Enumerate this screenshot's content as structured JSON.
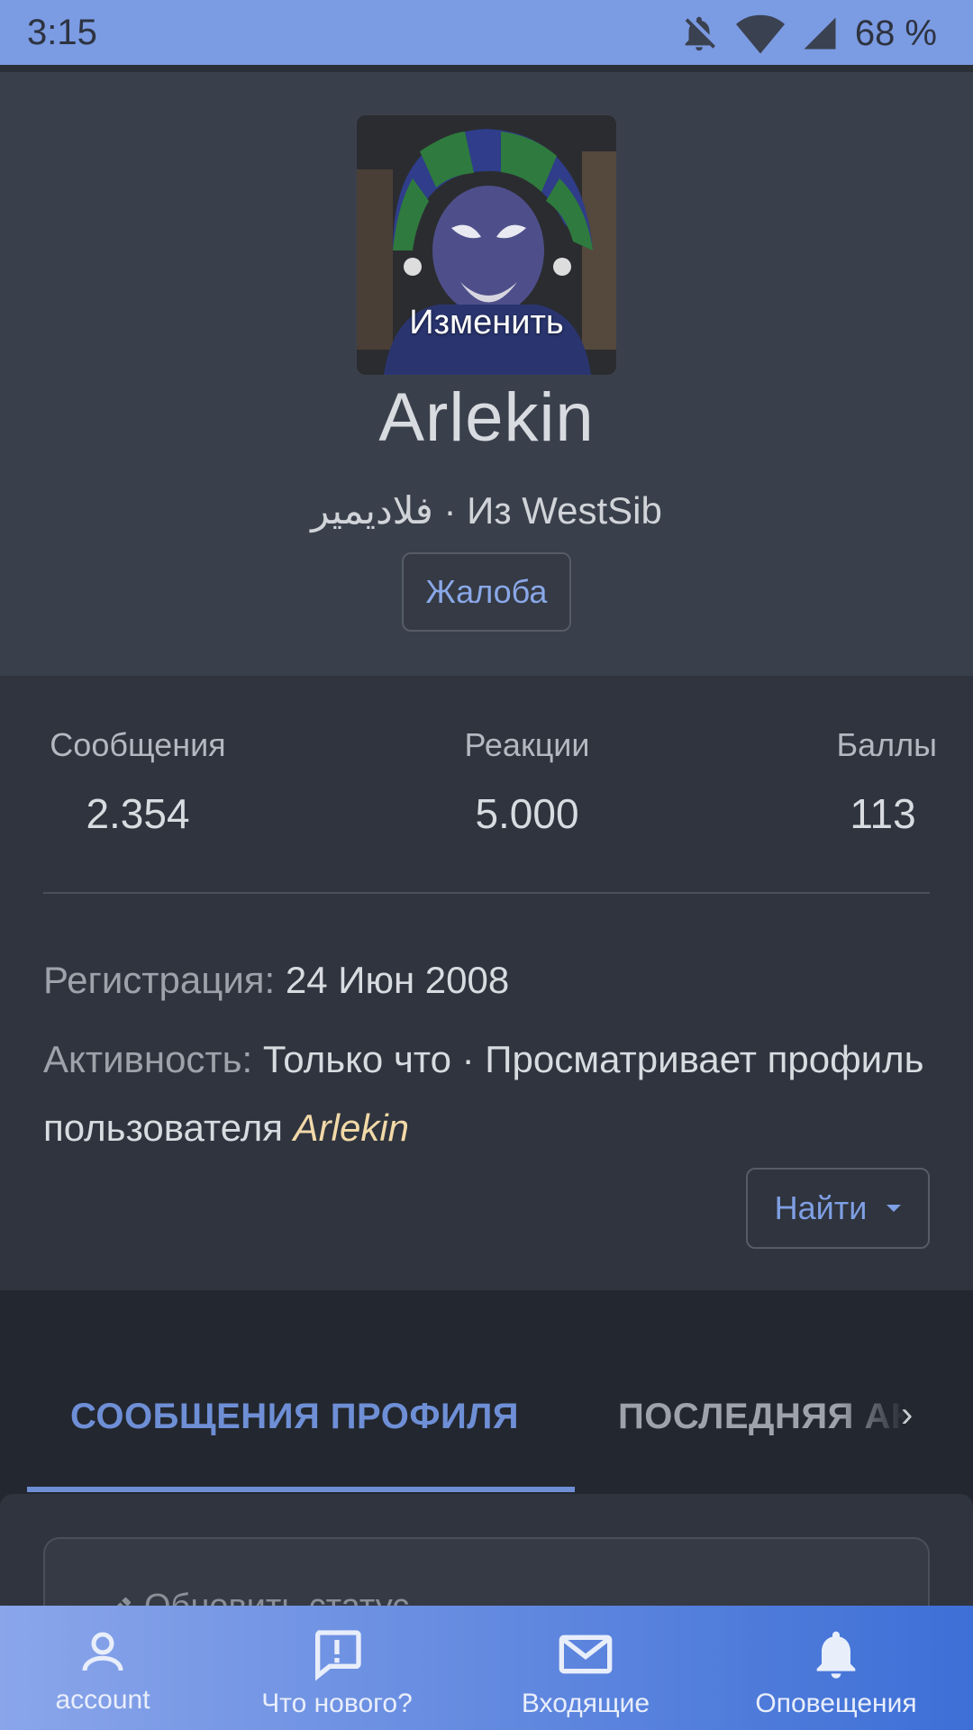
{
  "status_bar": {
    "time": "3:15",
    "battery": "68 %"
  },
  "profile": {
    "avatar_edit_label": "Изменить",
    "username": "Arlekin",
    "subtitle_name": "فلاديمير",
    "subtitle_separator": " · ",
    "subtitle_location": "Из WestSib",
    "report_label": "Жалоба"
  },
  "stats": {
    "messages_label": "Сообщения",
    "messages_value": "2.354",
    "reactions_label": "Реакции",
    "reactions_value": "5.000",
    "points_label": "Баллы",
    "points_value": "113"
  },
  "info": {
    "registration_label": "Регистрация:",
    "registration_value": "24 Июн 2008",
    "activity_label": "Активность:",
    "activity_value": "Только что · Просматривает профиль пользователя",
    "activity_link": "Arlekin",
    "find_label": "Найти"
  },
  "tabs": [
    {
      "label": "СООБЩЕНИЯ ПРОФИЛЯ"
    },
    {
      "label": "ПОСЛЕДНЯЯ АКТИВНОСТЬ"
    }
  ],
  "content": {
    "placeholder": "Обновить статус..."
  },
  "bottom_nav": [
    {
      "label": "account",
      "icon": "account-icon"
    },
    {
      "label": "Что нового?",
      "icon": "whats-new-icon"
    },
    {
      "label": "Входящие",
      "icon": "inbox-icon"
    },
    {
      "label": "Оповещения",
      "icon": "bell-icon"
    }
  ],
  "colors": {
    "accent": "#6e8fd6",
    "status_bar": "#7b9be3",
    "link": "#f2d9a8"
  }
}
